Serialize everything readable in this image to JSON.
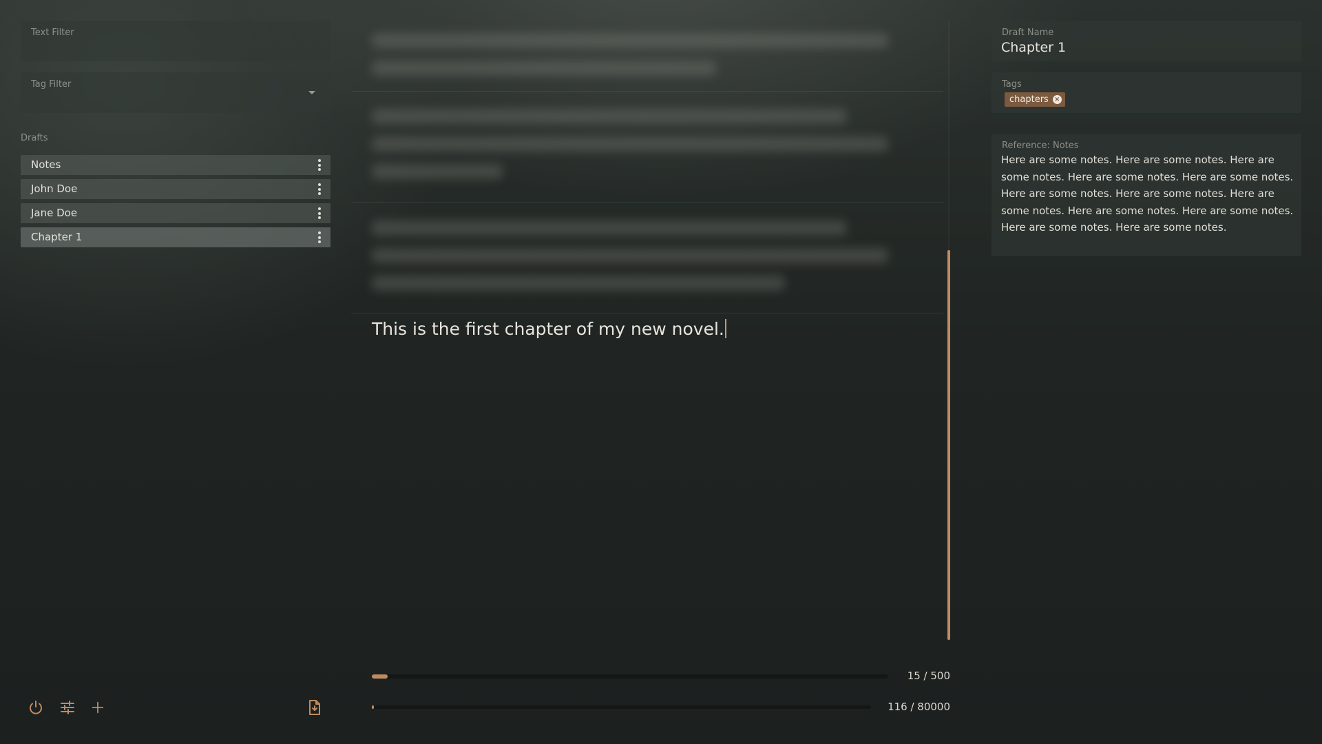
{
  "sidebar": {
    "text_filter": {
      "label": "Text Filter",
      "value": ""
    },
    "tag_filter": {
      "label": "Tag Filter",
      "value": ""
    },
    "drafts_title": "Drafts",
    "items": [
      {
        "label": "Notes"
      },
      {
        "label": "John Doe"
      },
      {
        "label": "Jane Doe"
      },
      {
        "label": "Chapter 1"
      }
    ],
    "bottom_icons": [
      "power-icon",
      "sliders-icon",
      "plus-icon",
      "export-file-icon"
    ]
  },
  "editor": {
    "current_paragraph": "This is the first chapter of my new novel.",
    "paragraph_progress": {
      "current": 15,
      "goal": 500,
      "text": "15 / 500"
    },
    "total_progress": {
      "current": 116,
      "goal": 80000,
      "text": "116 / 80000"
    }
  },
  "details": {
    "draft_name_label": "Draft Name",
    "draft_name_value": "Chapter 1",
    "tags_label": "Tags",
    "tags": [
      "chapters"
    ],
    "reference_label": "Reference: Notes",
    "reference_text": "Here are some notes. Here are some notes. Here are some notes. Here are some notes. Here are some notes. Here are some notes. Here are some notes. Here are some notes. Here are some notes. Here are some notes. Here are some notes. Here are some notes."
  },
  "colors": {
    "accent": "#c08b62",
    "tag_chip": "#7b5a3f",
    "active_item": "#707874"
  }
}
